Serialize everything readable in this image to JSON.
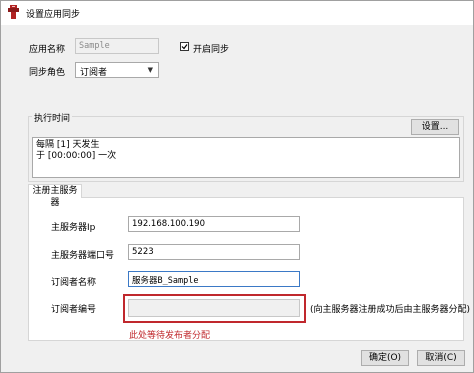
{
  "window": {
    "title": "设置应用同步"
  },
  "form": {
    "app_name_label": "应用名称",
    "app_name_value": "Sample",
    "enable_sync_label": "开启同步",
    "sync_role_label": "同步角色",
    "sync_role_value": "订阅者"
  },
  "schedule": {
    "group_title": "执行时间",
    "settings_button": "设置...",
    "description_line1": "每隔 [1] 天发生",
    "description_line2": "于 [00:00:00] 一次"
  },
  "registration": {
    "tab_label": "注册主服务器",
    "server_ip_label": "主服务器Ip",
    "server_ip_value": "192.168.100.190",
    "server_port_label": "主服务器端口号",
    "server_port_value": "5223",
    "subscriber_name_label": "订阅者名称",
    "subscriber_name_value": "服务器B_Sample",
    "subscriber_id_label": "订阅者编号",
    "subscriber_id_value": "",
    "subscriber_id_note": "(向主服务器注册成功后由主服务器分配)",
    "annotation_hint": "此处等待发布者分配"
  },
  "footer": {
    "ok_button": "确定(O)",
    "cancel_button": "取消(C)"
  },
  "colors": {
    "annotation_red": "#c0282d",
    "focus_border": "#3b79c6"
  }
}
